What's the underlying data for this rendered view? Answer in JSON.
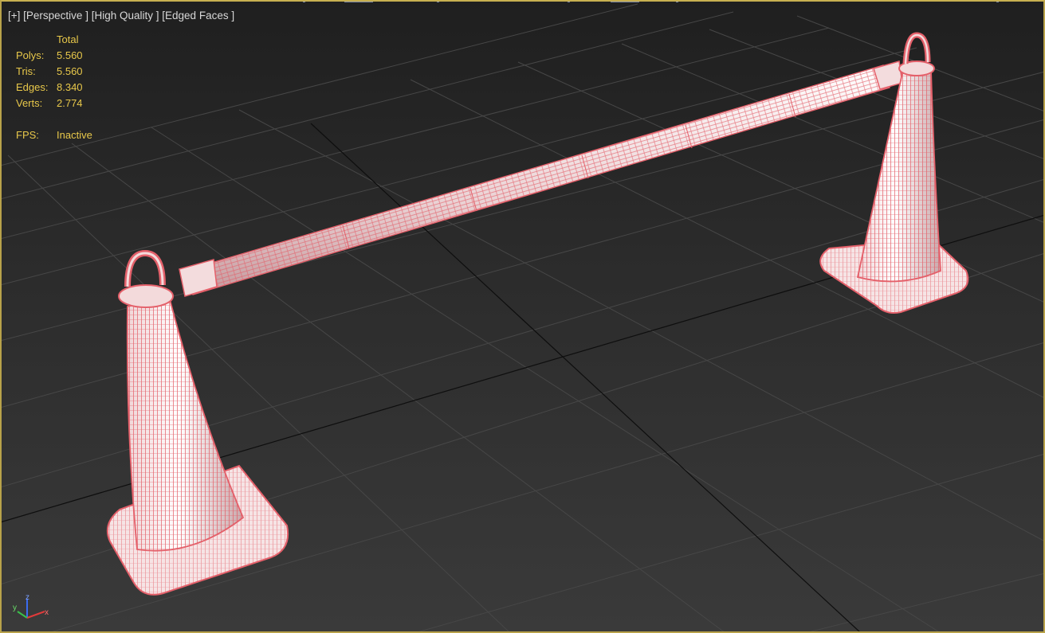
{
  "viewport": {
    "labels": {
      "plus": "[+]",
      "view": "[Perspective ]",
      "shading": "[High Quality ]",
      "faces": "[Edged Faces ]"
    },
    "stats": {
      "header": "Total",
      "rows": [
        {
          "label": "Polys:",
          "value": "5.560"
        },
        {
          "label": "Tris:",
          "value": "5.560"
        },
        {
          "label": "Edges:",
          "value": "8.340"
        },
        {
          "label": "Verts:",
          "value": "2.774"
        }
      ],
      "fps_label": "FPS:",
      "fps_value": "Inactive"
    },
    "axis": {
      "x": "x",
      "y": "y",
      "z": "z"
    },
    "colors": {
      "stats_text": "#e8c84a",
      "wire": "#e4606a",
      "frame": "#b8a24a",
      "grid": "#4a4a4a"
    }
  }
}
